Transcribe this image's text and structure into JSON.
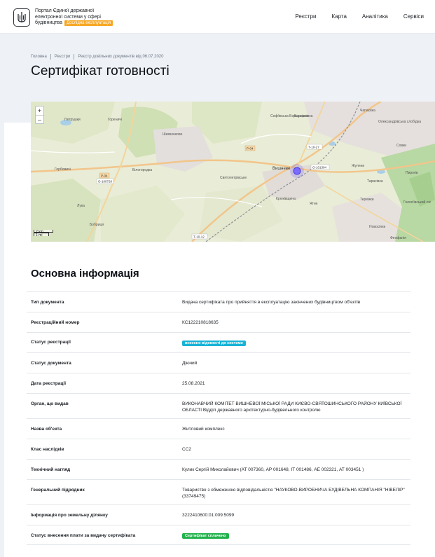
{
  "header": {
    "portal_line1": "Портал Єдиної державної",
    "portal_line2": "електронної системи у сфері",
    "portal_line3": "будівництва",
    "beta_badge": "Дослідна експлуатація",
    "nav": [
      "Реєстри",
      "Карта",
      "Аналітика",
      "Сервіси"
    ]
  },
  "breadcrumb": [
    "Головна",
    "Реєстри",
    "Реєстр довільних документів від 06.07.2020"
  ],
  "page_title": "Сертифікат готовності",
  "map": {
    "zoom_in": "+",
    "zoom_out": "–",
    "scale_km": "2 km",
    "scale_mi": "1 mi",
    "labels": [
      "Петрушки",
      "Гореничі",
      "Горбовичі",
      "Шевченкове",
      "Софіївська Борщагівка",
      "Борщагівка",
      "Вишневе",
      "Святопетрівське",
      "Білогородка",
      "Крюківщина",
      "Лука",
      "Бобриця",
      "Тарасівка",
      "Теремки",
      "Жуляни",
      "Олександрівська слобідка",
      "Голосіївський ліс",
      "Новосілки",
      "Феофанія",
      "Пирогів",
      "Совки",
      "Чапаєвка",
      "Ятне",
      "Р-04",
      "Р-04",
      "О-100720",
      "Т-10-27",
      "О-101304",
      "Т-10-12"
    ],
    "accent": "#6a5cff"
  },
  "section_title": "Основна інформація",
  "info_rows": [
    {
      "key": "Тип документа",
      "value": "Видача сертифіката про прийняття в експлуатацію закінчених будівництвом об'єктів"
    },
    {
      "key": "Реєстраційний номер",
      "value": "КС122210818635"
    },
    {
      "key": "Статус реєстрації",
      "value": "внесено відомості до системи",
      "badge_color": "#19b3d6"
    },
    {
      "key": "Статус документа",
      "value": "Діючий"
    },
    {
      "key": "Дата реєстрації",
      "value": "25.08.2021"
    },
    {
      "key": "Орган, що видав",
      "value": "ВИКОНАВЧИЙ КОМІТЕТ ВИШНЕВОЇ МІСЬКОЇ РАДИ КИЄВО-СВЯТОШИНСЬКОГО РАЙОНУ КИЇВСЬКОЇ ОБЛАСТІ Відділ державного архітектурно-будівельного контролю"
    },
    {
      "key": "Назва об'єкта",
      "value": "Житловий комплекс"
    },
    {
      "key": "Клас наслідків",
      "value": "СС2"
    },
    {
      "key": "Технічний нагляд",
      "value": "Кулик Сергій Миколайович (АТ 007360, АР 001648, ІТ 001486, АЕ 002321, АТ 003451 )"
    },
    {
      "key": "Генеральний підрядник",
      "value": "Товариство з обмеженою відповідальністю \"НАУКОВО-ВИРОБНИЧА БУДІВЕЛЬНА КОМПАНІЯ \"НІВЕЛІР\"(33749475)"
    },
    {
      "key": "Інформація про земельну ділянку",
      "value": "3222410600:01:009:5099"
    },
    {
      "key": "Статус внесення плати за видачу сертифіката",
      "value": "Сертифікат сплачено",
      "badge_color": "#22b24c"
    }
  ]
}
